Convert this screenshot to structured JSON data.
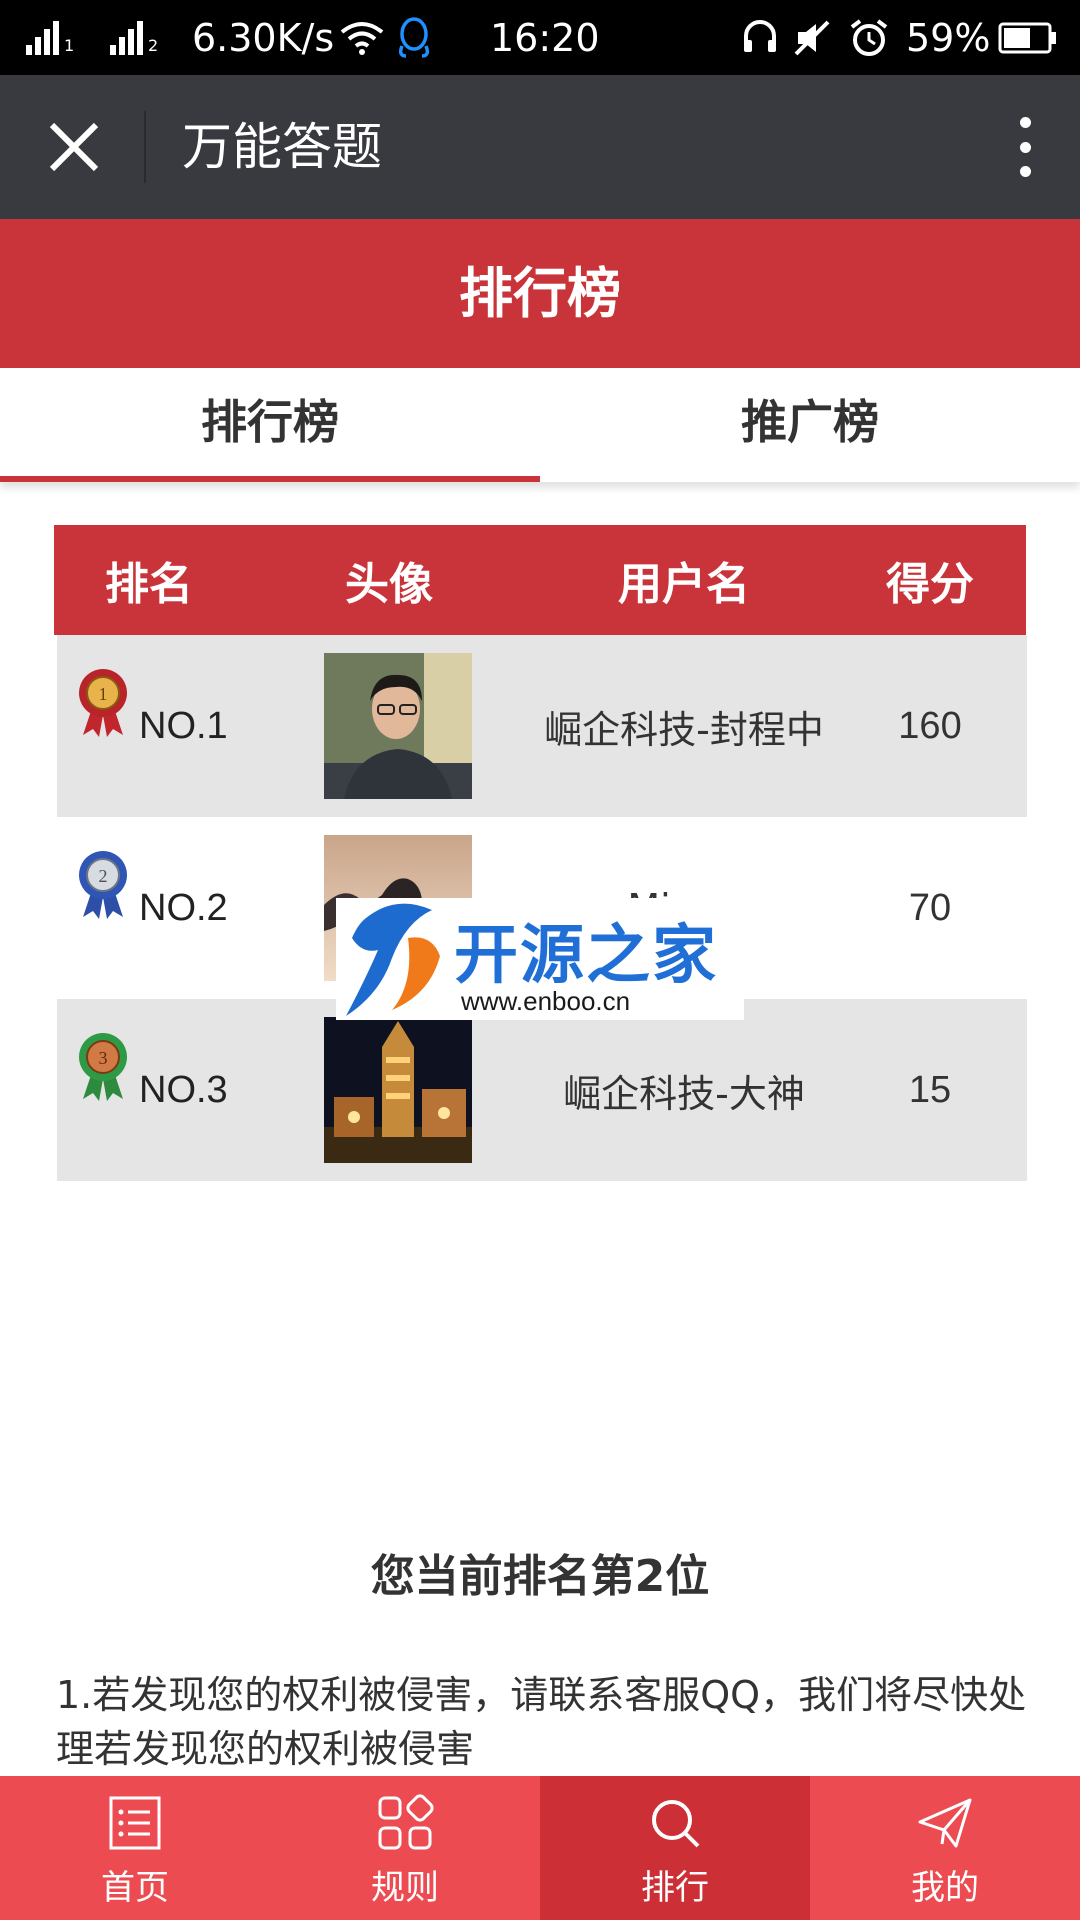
{
  "status_bar": {
    "sim1": "1",
    "sim2": "2",
    "network_speed": "6.30K/s",
    "time": "16:20",
    "battery": "59%"
  },
  "app_bar": {
    "title": "万能答题"
  },
  "banner": {
    "title": "排行榜"
  },
  "tabs": [
    {
      "label": "排行榜",
      "active": true
    },
    {
      "label": "推广榜",
      "active": false
    }
  ],
  "table": {
    "headers": [
      "排名",
      "头像",
      "用户名",
      "得分"
    ],
    "rows": [
      {
        "rank": "NO.1",
        "medal": "gold-medal-icon",
        "name": "崛企科技-封程中",
        "score": "160"
      },
      {
        "rank": "NO.2",
        "medal": "silver-medal-icon",
        "name": "Minya",
        "score": "70"
      },
      {
        "rank": "NO.3",
        "medal": "bronze-medal-icon",
        "name": "崛企科技-大神",
        "score": "15"
      }
    ]
  },
  "watermark": {
    "name": "开源之家",
    "url": "www.enboo.cn"
  },
  "current_rank": "您当前排名第2位",
  "notice": "1.若发现您的权利被侵害，请联系客服QQ，我们将尽快处理若发现您的权利被侵害",
  "bottom_nav": [
    {
      "label": "首页",
      "icon": "list-icon",
      "active": false
    },
    {
      "label": "规则",
      "icon": "grid-icon",
      "active": false
    },
    {
      "label": "排行",
      "icon": "search-icon",
      "active": true
    },
    {
      "label": "我的",
      "icon": "send-icon",
      "active": false
    }
  ],
  "colors": {
    "primary_red": "#c9343a",
    "nav_red": "#ec4c51",
    "nav_active": "#cc2f35",
    "app_bar": "#393a3f"
  }
}
